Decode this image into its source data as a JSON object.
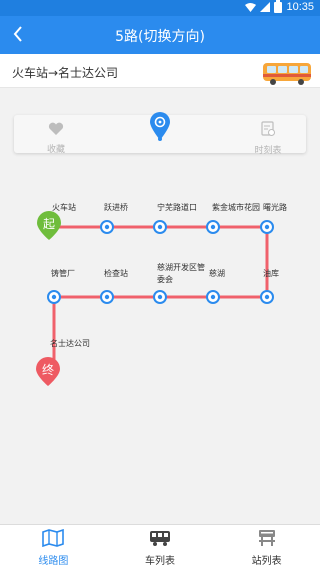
{
  "status_bar": {
    "time": "10:35"
  },
  "header": {
    "title": "5路(切换方向)"
  },
  "route": {
    "direction_text": "火车站→名士达公司"
  },
  "tabs": {
    "favorite_label": "收藏",
    "schedule_label": "时刻表"
  },
  "stations": {
    "s1": "火车站",
    "s2": "跃进桥",
    "s3": "宁芜路道口",
    "s4": "紫金城市花园",
    "s5": "曙光路",
    "s6": "油库",
    "s7": "慈湖",
    "s8_line1": "慈湖开发区管",
    "s8_line2": "委会",
    "s9": "检查站",
    "s10": "铸管厂",
    "s11": "名士达公司"
  },
  "markers": {
    "start": "起",
    "end": "终"
  },
  "colors": {
    "primary": "#2b8bee",
    "route_line": "#f0616c",
    "start_marker": "#6fbd3c",
    "end_marker": "#ee5a62"
  },
  "bottom_nav": {
    "route_map": "线路图",
    "bus_list": "车列表",
    "station_list": "站列表"
  }
}
